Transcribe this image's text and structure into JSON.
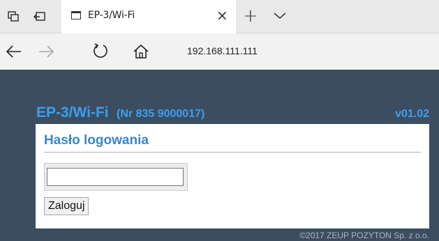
{
  "browser": {
    "tab_title": "EP-3/Wi-Fi",
    "tab_close_icon": "×",
    "new_tab_icon": "+",
    "address": "192.168.111.111",
    "icons": {
      "tab_actions": "tab-actions-icon",
      "set_tabs_aside": "set-tabs-aside-icon",
      "page": "page-icon",
      "close": "close-icon",
      "new_tab": "plus-icon",
      "tab_menu": "chevron-down-icon",
      "back": "back-arrow-icon",
      "forward": "forward-arrow-icon",
      "refresh": "refresh-icon",
      "home": "home-icon"
    }
  },
  "page": {
    "device_name": "EP-3/Wi-Fi",
    "serial": "(Nr 835 9000017)",
    "version": "v01.02",
    "panel_title": "Hasło logowania",
    "password_value": "",
    "login_label": "Zaloguj",
    "copyright": "©2017 ZEUP POZYTON Sp. z o.o.",
    "colors": {
      "background": "#3c4d61",
      "accent": "#3a9ff0",
      "panel_title": "#3b86cc"
    }
  }
}
